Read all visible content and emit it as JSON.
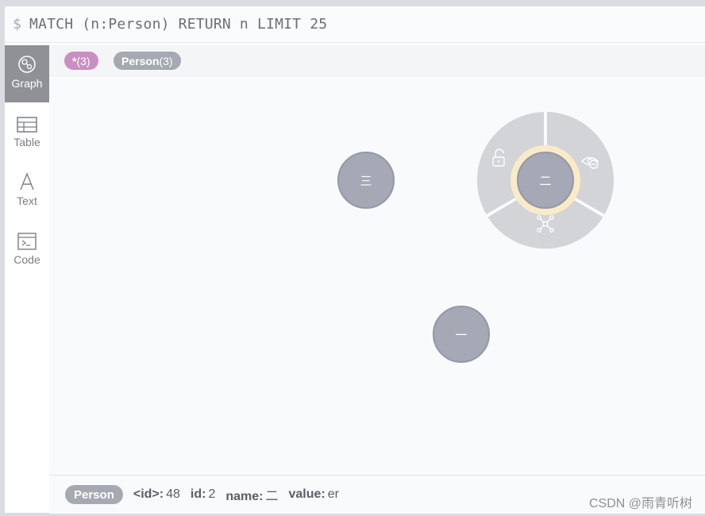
{
  "query": {
    "prompt": "$",
    "text": "MATCH (n:Person) RETURN n LIMIT 25"
  },
  "sidebar": {
    "items": [
      {
        "label": "Graph",
        "icon": "graph-icon",
        "active": true
      },
      {
        "label": "Table",
        "icon": "table-icon",
        "active": false
      },
      {
        "label": "Text",
        "icon": "text-icon",
        "active": false
      },
      {
        "label": "Code",
        "icon": "code-icon",
        "active": false
      }
    ]
  },
  "legend": {
    "all": {
      "label": "*",
      "count": "(3)"
    },
    "person": {
      "label": "Person",
      "count": "(3)"
    }
  },
  "graph": {
    "nodes": [
      {
        "caption": "三",
        "selected": false
      },
      {
        "caption": "二",
        "selected": true
      },
      {
        "caption": "一",
        "selected": false
      }
    ],
    "ring_icons": [
      "unlock-icon",
      "hide-icon",
      "expand-icon"
    ]
  },
  "status": {
    "label": "Person",
    "props": [
      {
        "key": "<id>:",
        "value": "48"
      },
      {
        "key": "id:",
        "value": "2"
      },
      {
        "key": "name:",
        "value": "二"
      },
      {
        "key": "value:",
        "value": "er"
      }
    ]
  },
  "watermark": "CSDN @雨青听树",
  "colors": {
    "node": "#a5a9b6",
    "node_border": "#9498a5",
    "ring": "#d2d4d8",
    "selection_halo": "#f9ebc8",
    "all_pill": "#c98fc2",
    "person_pill": "#a5a9b1"
  }
}
